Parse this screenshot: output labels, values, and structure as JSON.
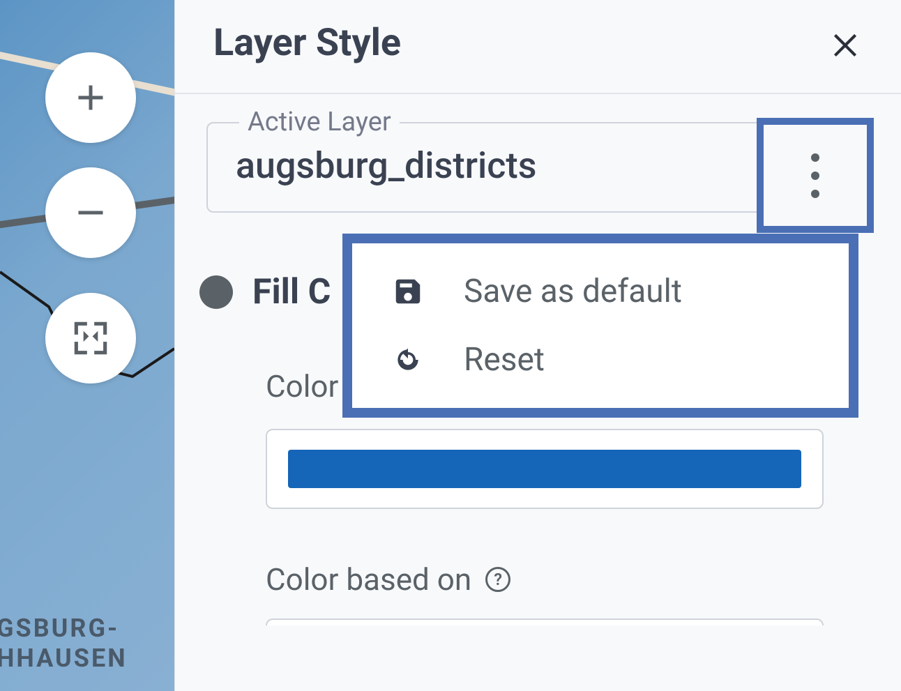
{
  "panel": {
    "title": "Layer Style",
    "active_layer_legend": "Active Layer",
    "active_layer_value": "augsburg_districts"
  },
  "menu": {
    "save_default": "Save as default",
    "reset": "Reset"
  },
  "section": {
    "fill_color_prefix": "Fill C",
    "color_label": "Color",
    "color_based_on": "Color based on",
    "swatch_hex": "#1565b8"
  },
  "map": {
    "label_line1": "GSBURG-",
    "label_line2": "HHAUSEN"
  },
  "icons": {
    "plus": "plus-icon",
    "minus": "minus-icon",
    "fullscreen": "fullscreen-icon",
    "close": "close-icon",
    "caret": "caret-down-icon",
    "more": "more-vert-icon",
    "save": "save-icon",
    "reset": "refresh-icon",
    "help": "help-icon"
  }
}
